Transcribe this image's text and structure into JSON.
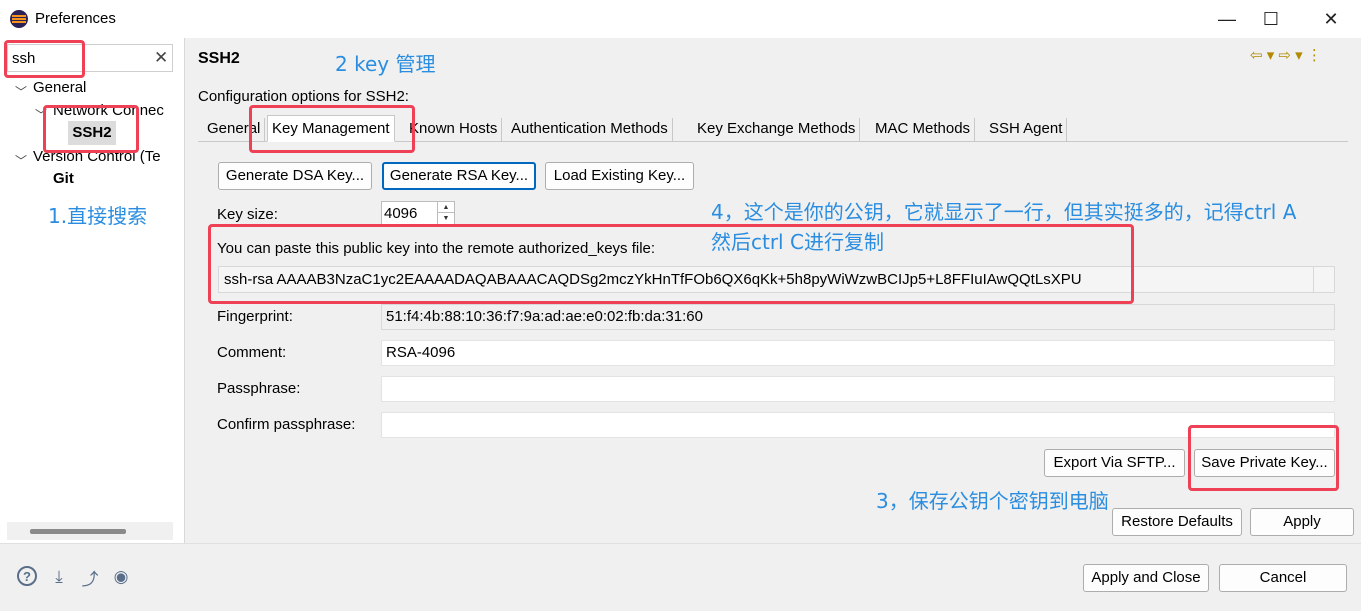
{
  "window": {
    "title": "Preferences",
    "minimize_glyph": "—",
    "maximize_glyph": "☐",
    "close_glyph": "✕"
  },
  "sidebar": {
    "filter_value": "ssh",
    "clear_glyph": "✕",
    "tree": [
      {
        "label": "General",
        "twisty": "﹀"
      },
      {
        "label": "Network Connec",
        "twisty": "﹀"
      },
      {
        "label": "SSH2"
      },
      {
        "label": "Version Control (Te",
        "twisty": "﹀"
      },
      {
        "label": "Git"
      }
    ]
  },
  "main": {
    "page_title": "SSH2",
    "nav_glyphs": "⇦ ▾  ⇨ ▾  ⋮",
    "config_label": "Configuration options for SSH2:",
    "tabs": [
      {
        "label": "General"
      },
      {
        "label": "Key Management",
        "active": true
      },
      {
        "label": "Known Hosts"
      },
      {
        "label": "Authentication Methods"
      },
      {
        "label": "Key Exchange Methods"
      },
      {
        "label": "MAC Methods"
      },
      {
        "label": "SSH Agent"
      }
    ],
    "buttons": {
      "generate_dsa": "Generate DSA Key...",
      "generate_rsa": "Generate RSA Key...",
      "load_existing": "Load Existing Key...",
      "export_sftp": "Export Via SFTP...",
      "save_private": "Save Private Key...",
      "restore_defaults": "Restore Defaults",
      "apply": "Apply"
    },
    "key_size_label": "Key size:",
    "key_size_value": "4096",
    "spin_up": "▲",
    "spin_down": "▼",
    "paste_label": "You can paste this public key into the remote authorized_keys file:",
    "public_key": "ssh-rsa AAAAB3NzaC1yc2EAAAADAQABAAACAQDSg2mczYkHnTfFOb6QX6qKk+5h8pyWiWzwBCIJp5+L8FFIuIAwQQtLsXPU",
    "fingerprint_label": "Fingerprint:",
    "fingerprint_value": "51:f4:4b:88:10:36:f7:9a:ad:ae:e0:02:fb:da:31:60",
    "comment_label": "Comment:",
    "comment_value": "RSA-4096",
    "passphrase_label": "Passphrase:",
    "passphrase_value": "",
    "confirm_label": "Confirm passphrase:",
    "confirm_value": ""
  },
  "footer": {
    "apply_close": "Apply and Close",
    "cancel": "Cancel",
    "icons": [
      "help-icon",
      "import-icon",
      "export-icon",
      "record-icon"
    ],
    "icon_glyphs": [
      "?",
      "⤓",
      "⤴",
      "◉"
    ]
  },
  "annotations": {
    "step1": "1.直接搜索",
    "step2": "2 key 管理",
    "step3": "3，保存公钥个密钥到电脑",
    "step4_line1": "4，这个是你的公钥，它就显示了一行，但其实挺多的，记得ctrl A",
    "step4_line2": "然后ctrl C进行复制",
    "highlight_color": "#ee4156",
    "text_color": "#2a8de0"
  }
}
